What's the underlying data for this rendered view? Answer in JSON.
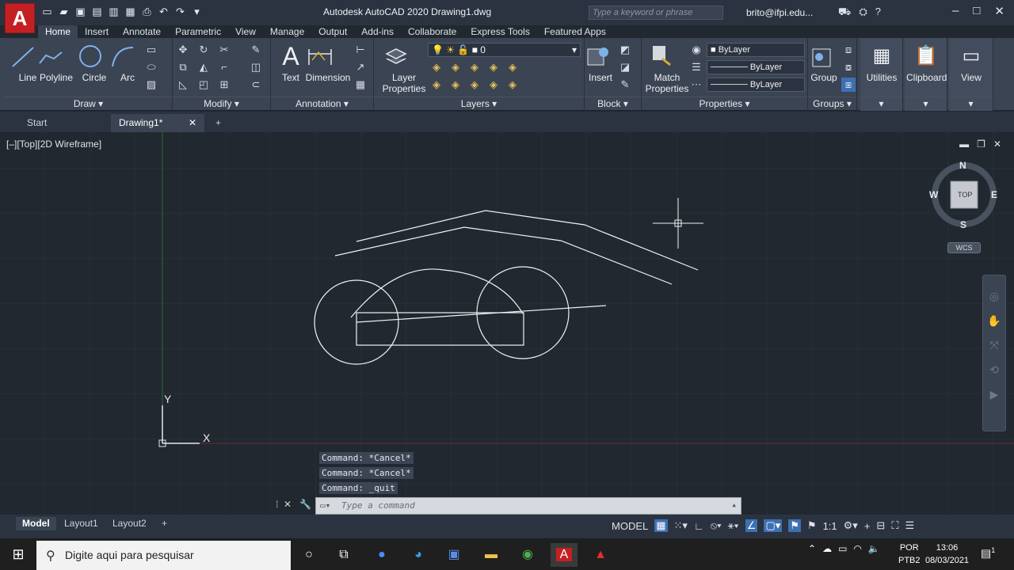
{
  "title_bar": {
    "app_title": "Autodesk AutoCAD 2020   Drawing1.dwg",
    "logo_letter": "A",
    "search_placeholder": "Type a keyword or phrase",
    "user": "brito@ifpi.edu..."
  },
  "ribbon_tabs": [
    "Home",
    "Insert",
    "Annotate",
    "Parametric",
    "View",
    "Manage",
    "Output",
    "Add-ins",
    "Collaborate",
    "Express Tools",
    "Featured Apps"
  ],
  "ribbon": {
    "draw": {
      "label": "Draw",
      "line": "Line",
      "polyline": "Polyline",
      "circle": "Circle",
      "arc": "Arc"
    },
    "modify": {
      "label": "Modify"
    },
    "annotation": {
      "label": "Annotation",
      "text": "Text",
      "dimension": "Dimension"
    },
    "layers": {
      "label": "Layers",
      "layer_properties": "Layer Properties",
      "current_layer": "0"
    },
    "block": {
      "label": "Block",
      "insert": "Insert"
    },
    "properties": {
      "label": "Properties",
      "match": "Match Properties",
      "color": "ByLayer",
      "linetype": "ByLayer",
      "lineweight": "ByLayer"
    },
    "groups": {
      "label": "Groups",
      "group": "Group"
    },
    "utilities": "Utilities",
    "clipboard": "Clipboard",
    "view": "View"
  },
  "file_tabs": {
    "start": "Start",
    "drawing": "Drawing1*"
  },
  "viewport": {
    "label": "[–][Top][2D Wireframe]",
    "viewcube": {
      "n": "N",
      "s": "S",
      "e": "E",
      "w": "W",
      "face": "TOP",
      "wcs": "WCS"
    },
    "ucs": {
      "x": "X",
      "y": "Y"
    }
  },
  "command_history": [
    "Command: *Cancel*",
    "Command: *Cancel*",
    "Command: _quit"
  ],
  "command_placeholder": "Type a command",
  "layout_tabs": [
    "Model",
    "Layout1",
    "Layout2"
  ],
  "status": {
    "model": "MODEL",
    "scale": "1:1"
  },
  "taskbar": {
    "search_placeholder": "Digite aqui para pesquisar",
    "lang_top": "POR",
    "lang_bottom": "PTB2",
    "time": "13:06",
    "date": "08/03/2021",
    "notifications": "1"
  },
  "colors": {
    "accent": "#3d6fb3",
    "viewport_bg": "#212830",
    "ribbon_bg": "#3b4453",
    "autocad_red": "#c42024"
  }
}
